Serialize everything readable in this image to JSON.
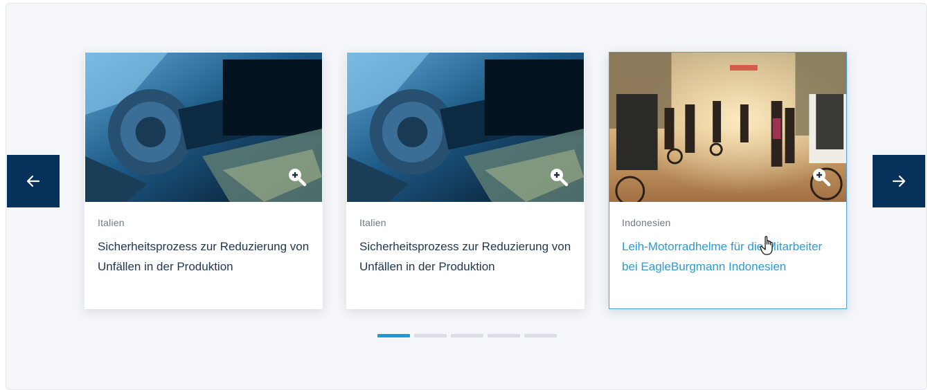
{
  "carousel": {
    "prev_icon": "arrow-left-icon",
    "next_icon": "arrow-right-icon",
    "cards": [
      {
        "country": "Italien",
        "title": "Sicherheitsprozess zur Reduzierung von Unfällen in der Produktion",
        "image": "industrial-machine-photo",
        "zoom_icon": "zoom-in-icon"
      },
      {
        "country": "Italien",
        "title": "Sicherheitsprozess zur Reduzierung von Unfällen in der Produktion",
        "image": "industrial-machine-photo",
        "zoom_icon": "zoom-in-icon"
      },
      {
        "country": "Indonesien",
        "title": "Leih-Motorradhelme für die Mitarbeiter bei EagleBurgmann Indonesien",
        "image": "street-traffic-photo",
        "zoom_icon": "zoom-in-icon"
      }
    ],
    "pagination": {
      "total": 5,
      "active": 1
    }
  },
  "colors": {
    "nav_bg": "#05315a",
    "accent": "#1a9ad6",
    "title_text": "#1f3650",
    "hover_link": "#2a9bd6",
    "panel_bg": "#f5f6f9"
  }
}
